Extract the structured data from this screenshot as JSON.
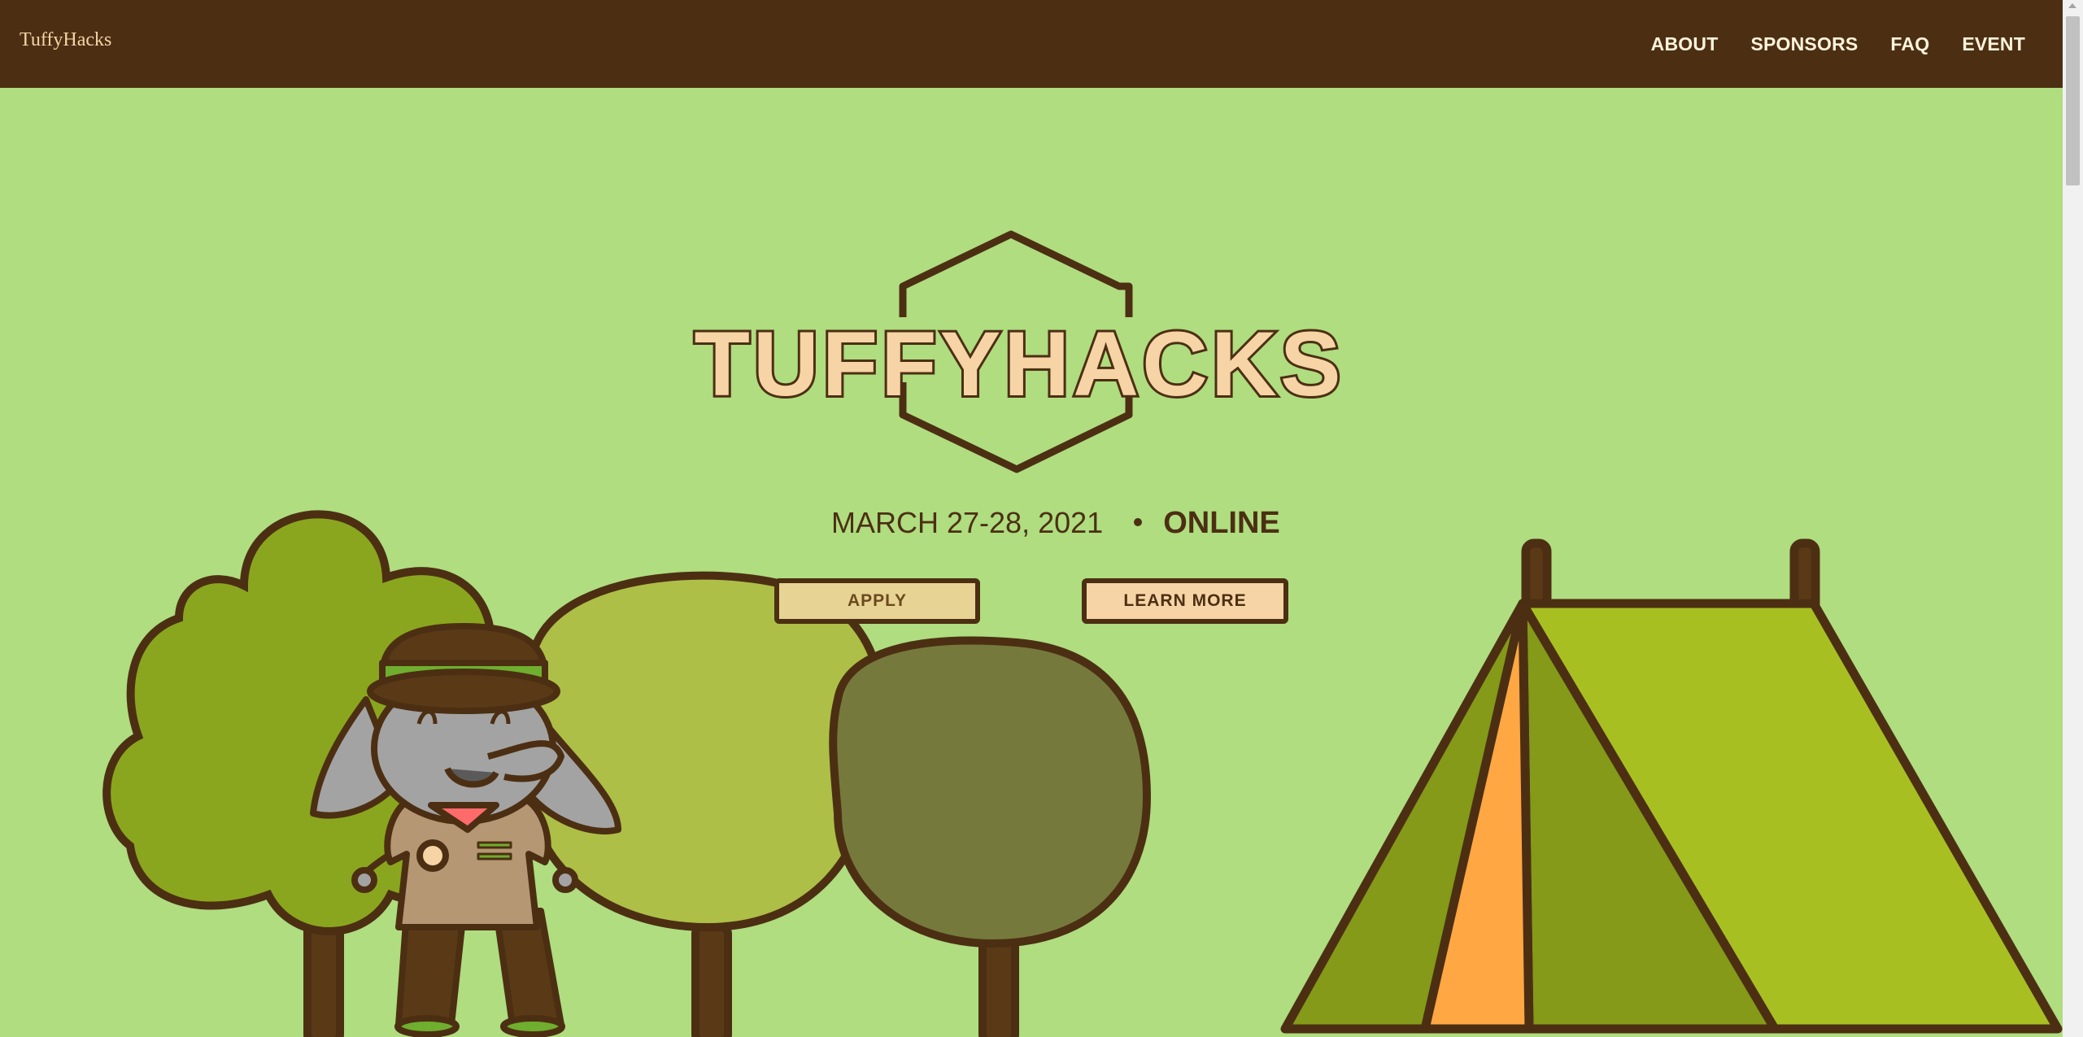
{
  "nav": {
    "brand": "TuffyHacks",
    "links": [
      "ABOUT",
      "SPONSORS",
      "FAQ",
      "EVENT"
    ]
  },
  "hero": {
    "logo_text": "TUFFYHACKS",
    "date": "MARCH 27-28, 2021",
    "location": "ONLINE",
    "apply_label": "APPLY",
    "learn_more_label": "LEARN MORE"
  },
  "colors": {
    "background": "#afdd80",
    "navbar": "#4c2f13",
    "accent": "#f6d4a5",
    "outline": "#4c2f13"
  },
  "icons": [
    "tuffy-elephant-mascot",
    "tent-illustration",
    "tree-illustration"
  ]
}
